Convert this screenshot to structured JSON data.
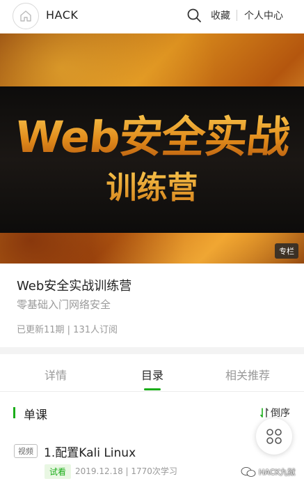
{
  "header": {
    "brand": "HACK",
    "favorite_label": "收藏",
    "profile_label": "个人中心"
  },
  "banner": {
    "title": "Web安全实战",
    "subtitle": "训练营",
    "badge": "专栏"
  },
  "course": {
    "title": "Web安全实战训练营",
    "subtitle": "零基础入门网络安全",
    "meta": "已更新11期 | 131人订阅"
  },
  "tabs": [
    {
      "label": "详情",
      "active": false
    },
    {
      "label": "目录",
      "active": true
    },
    {
      "label": "相关推荐",
      "active": false
    }
  ],
  "section": {
    "title": "单课",
    "order_label": "倒序"
  },
  "lessons": [
    {
      "type_tag": "视频",
      "title": "1.配置Kali Linux",
      "trial_tag": "试看",
      "meta": "2019.12.18 | 1770次学习"
    }
  ],
  "watermark": "HACK九狱",
  "colors": {
    "accent": "#1aad19",
    "muted": "#999999"
  },
  "icons": [
    "home-icon",
    "search-icon",
    "sort-icon",
    "grid-menu-icon",
    "wechat-icon"
  ]
}
